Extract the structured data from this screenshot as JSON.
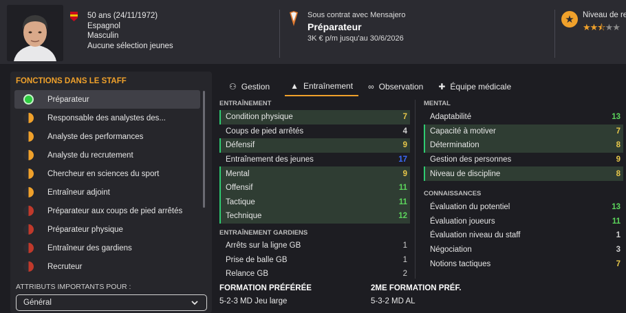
{
  "header": {
    "age_birth": "50 ans (24/11/1972)",
    "nationality": "Espagnol",
    "gender": "Masculin",
    "youth": "Aucune sélection jeunes",
    "contract_label": "Sous contrat avec Mensajero",
    "role": "Préparateur",
    "contract_terms": "3K € p/m jusqu'au 30/6/2026",
    "reputation_label": "Niveau de re",
    "reputation_stars": 2.5,
    "reputation_stars_text": "★★⯪",
    "reputation_stars_empty": "★★"
  },
  "staff_functions": {
    "title": "FONCTIONS DANS LE STAFF",
    "items": [
      {
        "label": "Préparateur",
        "level": "full"
      },
      {
        "label": "Responsable des analystes des...",
        "level": "orange"
      },
      {
        "label": "Analyste des performances",
        "level": "orange"
      },
      {
        "label": "Analyste du recrutement",
        "level": "orange"
      },
      {
        "label": "Chercheur en sciences du sport",
        "level": "orange"
      },
      {
        "label": "Entraîneur adjoint",
        "level": "orange"
      },
      {
        "label": "Préparateur aux coups de pied arrêtés",
        "level": "red"
      },
      {
        "label": "Préparateur physique",
        "level": "red"
      },
      {
        "label": "Entraîneur des gardiens",
        "level": "red"
      },
      {
        "label": "Recruteur",
        "level": "red"
      }
    ],
    "attr_label": "ATTRIBUTS IMPORTANTS POUR :",
    "select_value": "Général"
  },
  "tabs": [
    {
      "label": "Gestion",
      "icon": "people-icon"
    },
    {
      "label": "Entraînement",
      "icon": "cone-icon"
    },
    {
      "label": "Observation",
      "icon": "binoculars-icon"
    },
    {
      "label": "Équipe médicale",
      "icon": "medkit-icon"
    }
  ],
  "sections": {
    "training_title": "ENTRAÎNEMENT",
    "training": [
      {
        "label": "Condition physique",
        "value": "7",
        "hl": true,
        "color": "#e8c84a"
      },
      {
        "label": "Coups de pied arrêtés",
        "value": "4",
        "hl": false,
        "color": "#d0d0d0"
      },
      {
        "label": "Défensif",
        "value": "9",
        "hl": true,
        "color": "#e8c84a"
      },
      {
        "label": "Entraînement des jeunes",
        "value": "17",
        "hl": false,
        "color": "#3b6cff"
      },
      {
        "label": "Mental",
        "value": "9",
        "hl": true,
        "color": "#e8c84a"
      },
      {
        "label": "Offensif",
        "value": "11",
        "hl": true,
        "color": "#5cd65c"
      },
      {
        "label": "Tactique",
        "value": "11",
        "hl": true,
        "color": "#5cd65c"
      },
      {
        "label": "Technique",
        "value": "12",
        "hl": true,
        "color": "#5cd65c"
      }
    ],
    "gk_title": "ENTRAÎNEMENT GARDIENS",
    "gk": [
      {
        "label": "Arrêts sur la ligne GB",
        "value": "1"
      },
      {
        "label": "Prise de balle GB",
        "value": "1"
      },
      {
        "label": "Relance GB",
        "value": "2"
      }
    ],
    "mental_title": "MENTAL",
    "mental": [
      {
        "label": "Adaptabilité",
        "value": "13",
        "hl": false,
        "color": "#5cd65c"
      },
      {
        "label": "Capacité à motiver",
        "value": "7",
        "hl": true,
        "color": "#e8c84a"
      },
      {
        "label": "Détermination",
        "value": "8",
        "hl": true,
        "color": "#e8c84a"
      },
      {
        "label": "Gestion des personnes",
        "value": "9",
        "hl": false,
        "color": "#e8c84a"
      },
      {
        "label": "Niveau de discipline",
        "value": "8",
        "hl": true,
        "color": "#e8c84a"
      }
    ],
    "knowledge_title": "CONNAISSANCES",
    "knowledge": [
      {
        "label": "Évaluation du potentiel",
        "value": "13",
        "color": "#5cd65c"
      },
      {
        "label": "Évaluation joueurs",
        "value": "11",
        "color": "#5cd65c"
      },
      {
        "label": "Évaluation niveau du staff",
        "value": "1",
        "color": "#d0d0d0"
      },
      {
        "label": "Négociation",
        "value": "3",
        "color": "#d0d0d0"
      },
      {
        "label": "Notions tactiques",
        "value": "7",
        "color": "#e8c84a"
      }
    ]
  },
  "formations": {
    "pref_title": "FORMATION PRÉFÉRÉE",
    "pref_value": "5-2-3 MD Jeu large",
    "second_title": "2ME FORMATION PRÉF.",
    "second_value": "5-3-2 MD AL"
  }
}
